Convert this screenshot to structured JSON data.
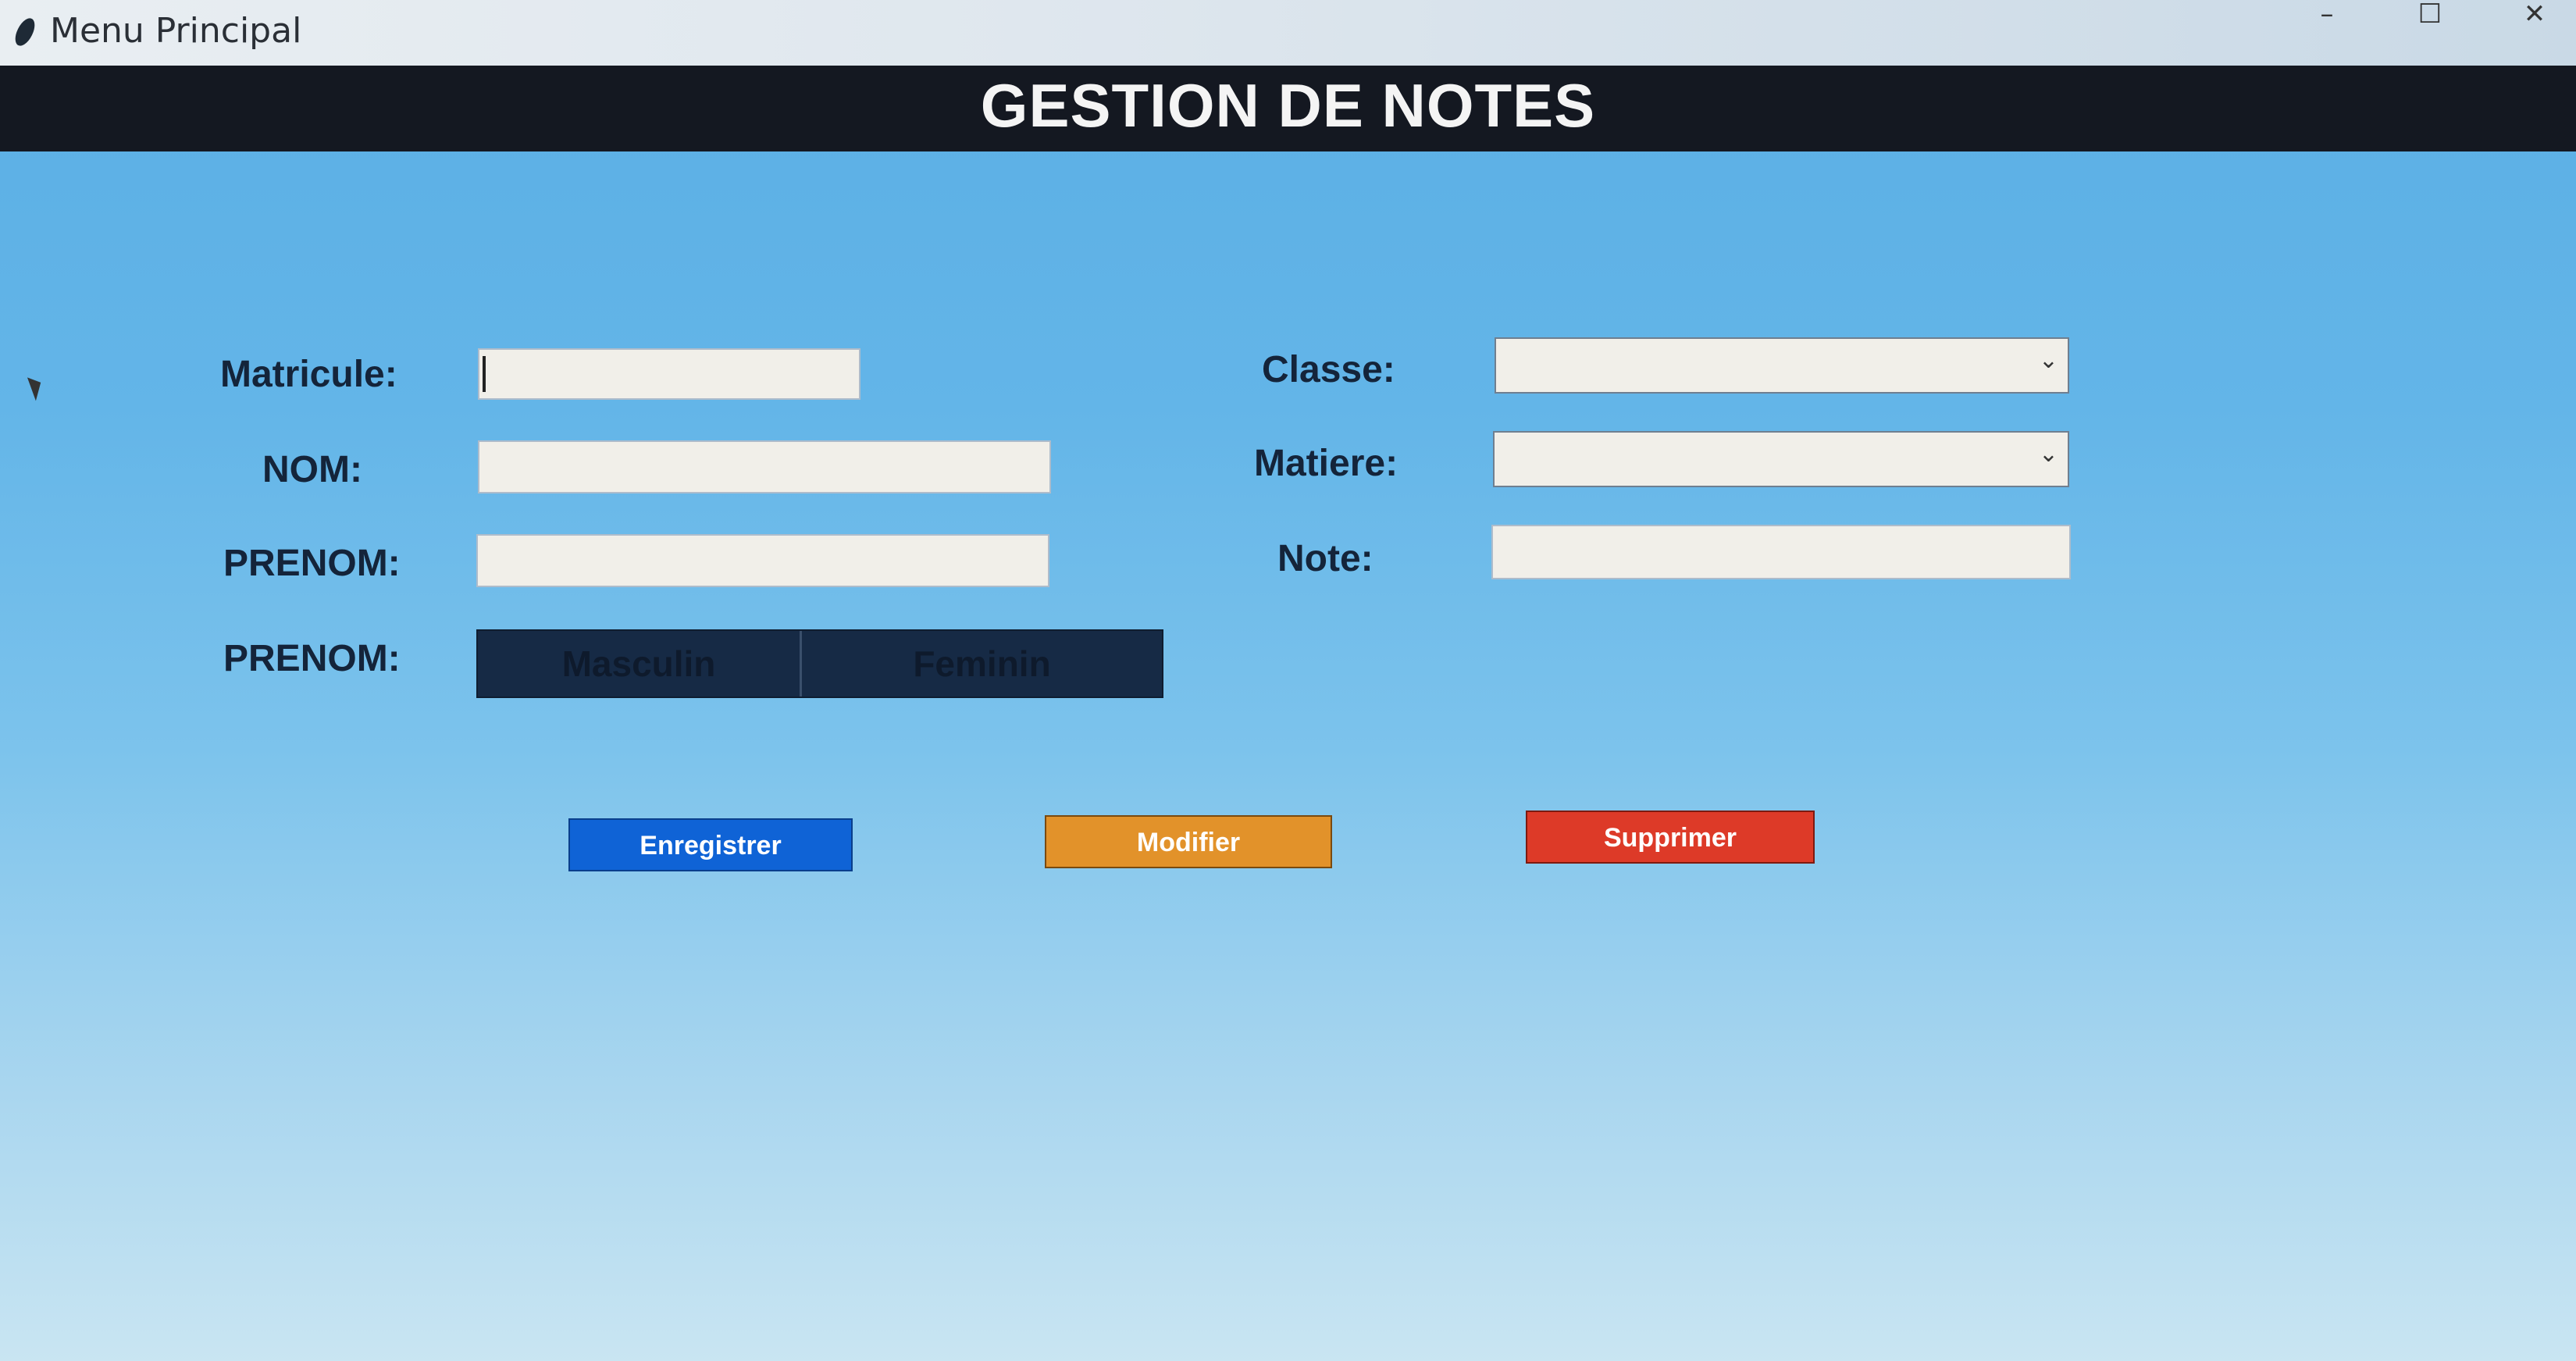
{
  "window": {
    "title": "Menu Principal",
    "controls": {
      "minimize": "–",
      "maximize": "☐",
      "close": "✕"
    }
  },
  "header": {
    "title": "GESTION DE NOTES"
  },
  "form": {
    "matricule": {
      "label": "Matricule:",
      "value": ""
    },
    "nom": {
      "label": "NOM:",
      "value": ""
    },
    "prenom": {
      "label": "PRENOM:",
      "value": ""
    },
    "sexe": {
      "label": "PRENOM:",
      "options": [
        "Masculin",
        "Feminin"
      ]
    },
    "classe": {
      "label": "Classe:",
      "value": "",
      "arrow": "⌄"
    },
    "matiere": {
      "label": "Matiere:",
      "value": "",
      "arrow": "⌄"
    },
    "note": {
      "label": "Note:",
      "value": ""
    }
  },
  "buttons": {
    "save": "Enregistrer",
    "edit": "Modifier",
    "delete": "Supprimer"
  },
  "colors": {
    "header_bg": "#141821",
    "save_btn": "#0f63d6",
    "edit_btn": "#e2922a",
    "delete_btn": "#dd3a28",
    "radio_bg": "#162a45"
  }
}
